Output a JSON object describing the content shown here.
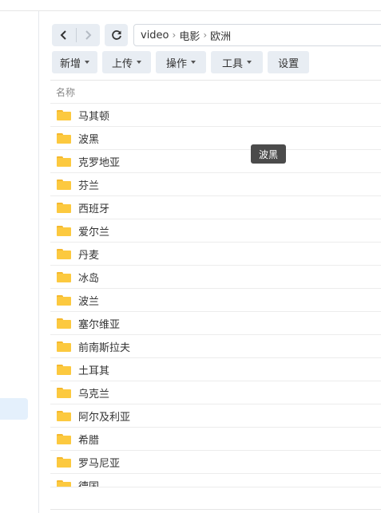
{
  "navigation": {
    "back_icon": "chevron-left-icon",
    "forward_icon": "chevron-right-icon",
    "refresh_icon": "refresh-icon"
  },
  "breadcrumb": [
    "video",
    "电影",
    "欧洲"
  ],
  "toolbar": {
    "new_label": "新增",
    "upload_label": "上传",
    "action_label": "操作",
    "tools_label": "工具",
    "settings_label": "设置"
  },
  "list": {
    "column_name": "名称",
    "items": [
      "马其顿",
      "波黑",
      "克罗地亚",
      "芬兰",
      "西班牙",
      "爱尔兰",
      "丹麦",
      "冰岛",
      "波兰",
      "塞尔维亚",
      "前南斯拉夫",
      "土耳其",
      "乌克兰",
      "阿尔及利亚",
      "希腊",
      "罗马尼亚",
      "德国"
    ]
  },
  "tooltip": "波黑",
  "colors": {
    "folder": "#fcc93f",
    "selected_sidebar": "#e4f0fc",
    "button_bg": "#e8edf3"
  }
}
